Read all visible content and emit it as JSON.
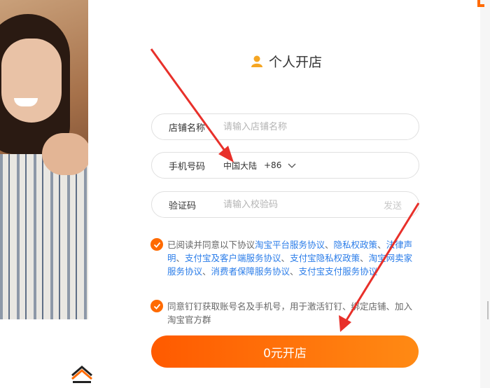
{
  "page": {
    "title": "个人开店",
    "title_icon": "person-icon"
  },
  "form": {
    "shop_name": {
      "label": "店铺名称",
      "placeholder": "请输入店铺名称"
    },
    "phone": {
      "label": "手机号码",
      "region": "中国大陆",
      "country_code": "+86"
    },
    "verify": {
      "label": "验证码",
      "placeholder": "请输入校验码",
      "send_label": "发送"
    }
  },
  "agreements": {
    "line1_prefix": "已阅读并同意以下协议",
    "links": [
      "淘宝平台服务协议",
      "隐私权政策",
      "法律声明",
      "支付宝及客户端服务协议",
      "支付宝隐私权政策",
      "淘宝网卖家服务协议",
      "消费者保障服务协议",
      "支付宝支付服务协议"
    ],
    "separator": "、",
    "line2": "同意钉钉获取账号名及手机号，用于激活钉钉、绑定店铺、加入淘宝官方群"
  },
  "submit": {
    "label": "0元开店"
  },
  "colors": {
    "accent": "#ff6a00",
    "link": "#2b7de9",
    "arrow": "#e8302a"
  }
}
